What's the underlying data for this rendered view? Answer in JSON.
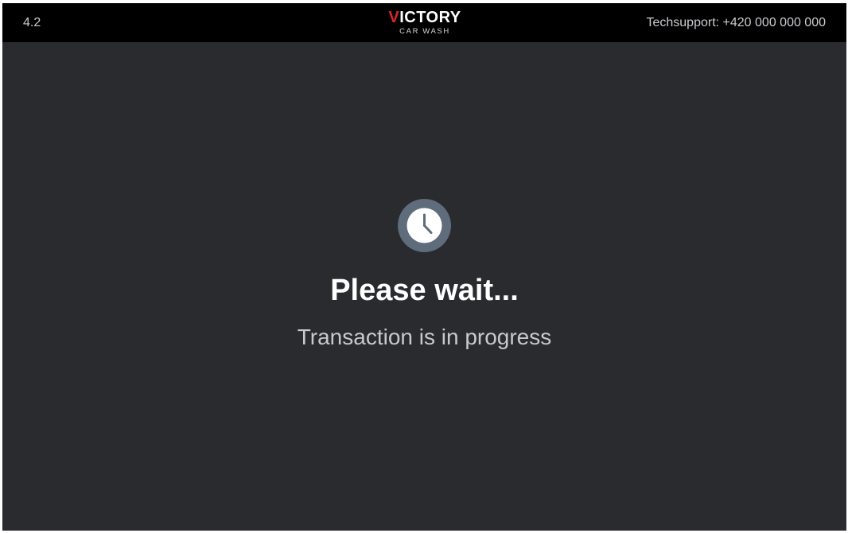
{
  "header": {
    "version": "4.2",
    "logo_text": "VICTORY",
    "logo_tagline": "CAR WASH",
    "support_text": "Techsupport: +420 000 000 000"
  },
  "status": {
    "icon": "clock-icon",
    "title": "Please wait...",
    "message": "Transaction is in progress"
  },
  "colors": {
    "topbar": "#000000",
    "background": "#2a2b2f",
    "icon_ring": "#5e6c7b",
    "icon_face": "#ffffff",
    "logo_accent": "#d8262b"
  }
}
